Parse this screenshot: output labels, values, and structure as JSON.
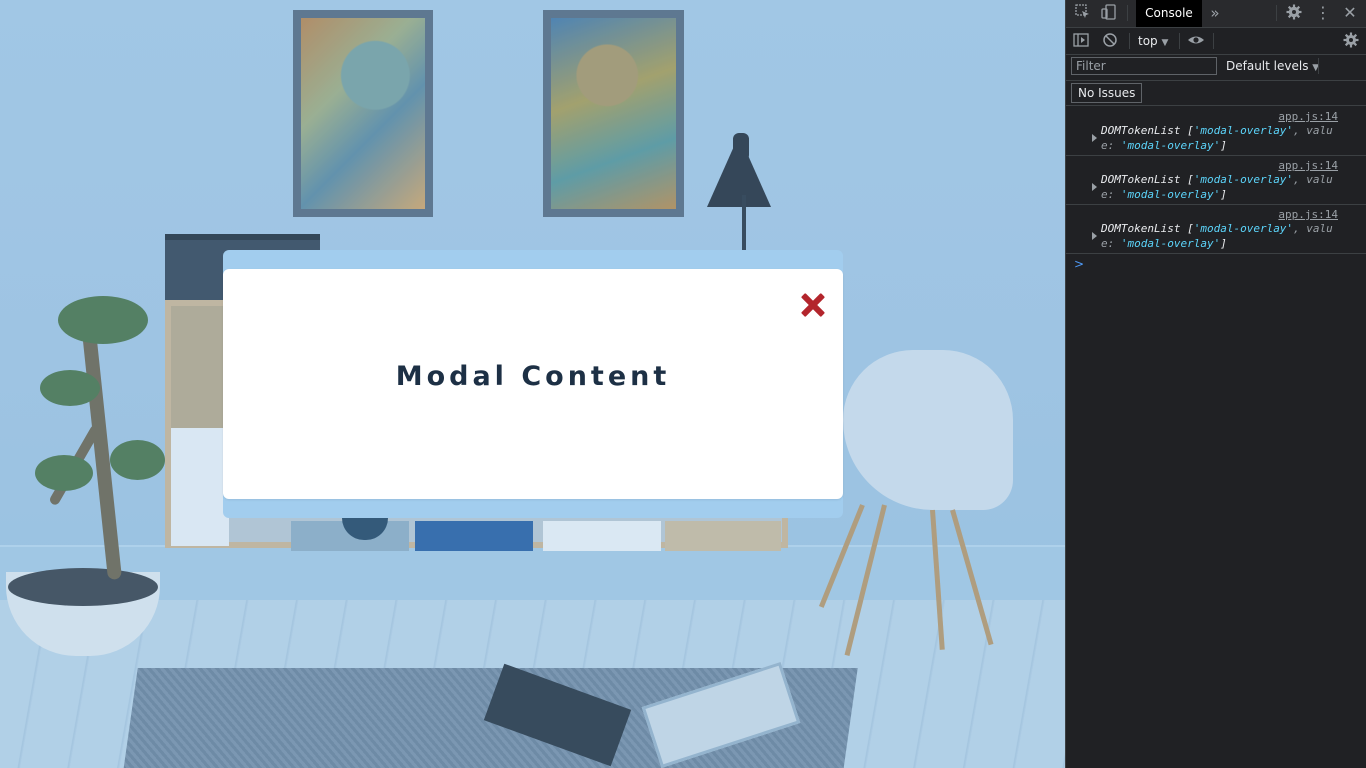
{
  "modal": {
    "title": "Modal Content",
    "close_icon": "close-x-icon",
    "close_color": "#b3252c",
    "title_color": "#1d3045",
    "backdrop_color": "#a2cdee"
  },
  "devtools": {
    "tab_console": "Console",
    "context": "top",
    "filter_placeholder": "Filter",
    "levels": "Default levels",
    "issues": "No Issues",
    "logs": [
      {
        "source": "app.js:14",
        "line1_prefix": "DOMTokenList [",
        "str1": "'modal-overlay'",
        "mid": ", valu",
        "line2_prefix": "e: ",
        "str2": "'modal-overlay'",
        "line2_suffix": "]"
      },
      {
        "source": "app.js:14",
        "line1_prefix": "DOMTokenList [",
        "str1": "'modal-overlay'",
        "mid": ", valu",
        "line2_prefix": "e: ",
        "str2": "'modal-overlay'",
        "line2_suffix": "]"
      },
      {
        "source": "app.js:14",
        "line1_prefix": "DOMTokenList [",
        "str1": "'modal-overlay'",
        "mid": ", valu",
        "line2_prefix": "e: ",
        "str2": "'modal-overlay'",
        "line2_suffix": "]"
      }
    ],
    "prompt_symbol": ">",
    "icons": [
      "inspect-icon",
      "device-toggle-icon",
      "more-tabs-icon",
      "settings-icon",
      "kebab-menu-icon",
      "close-icon",
      "sidebar-toggle-icon",
      "clear-console-icon",
      "eye-icon",
      "console-settings-icon"
    ]
  }
}
